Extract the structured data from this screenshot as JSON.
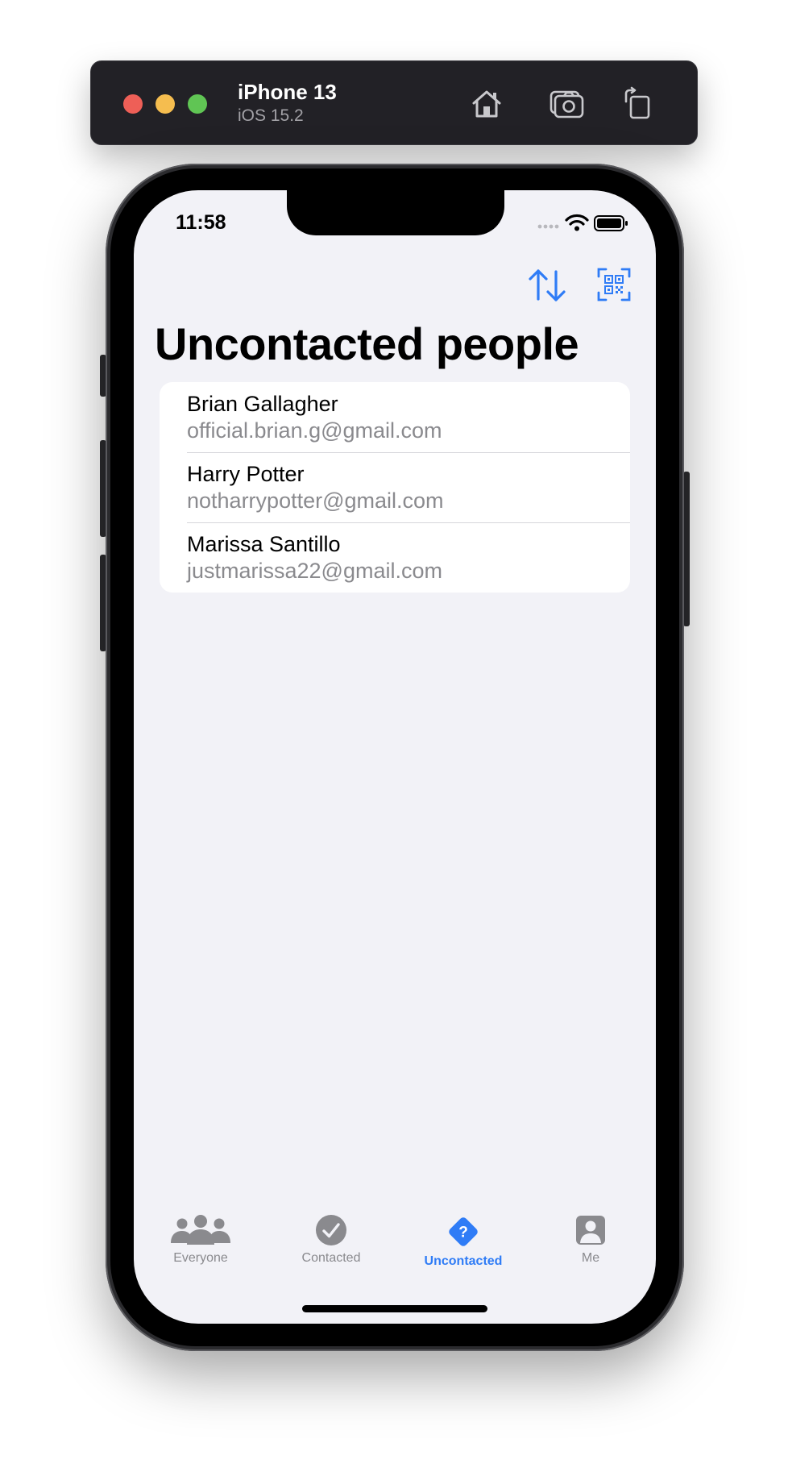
{
  "simulator": {
    "device_name": "iPhone 13",
    "os_version": "iOS 15.2",
    "buttons": {
      "home": "house-icon",
      "screenshot": "camera-icon",
      "rotate": "rotate-icon"
    }
  },
  "status_bar": {
    "time": "11:58"
  },
  "nav": {
    "title": "Uncontacted people",
    "actions": [
      "sort-arrows-icon",
      "qr-scan-icon"
    ]
  },
  "contacts": [
    {
      "name": "Brian Gallagher",
      "email": "official.brian.g@gmail.com"
    },
    {
      "name": "Harry Potter",
      "email": "notharrypotter@gmail.com"
    },
    {
      "name": "Marissa Santillo",
      "email": "justmarissa22@gmail.com"
    }
  ],
  "tabs": [
    {
      "label": "Everyone",
      "icon": "people-icon",
      "active": false
    },
    {
      "label": "Contacted",
      "icon": "checkmark-circle-icon",
      "active": false
    },
    {
      "label": "Uncontacted",
      "icon": "question-diamond-icon",
      "active": true
    },
    {
      "label": "Me",
      "icon": "person-square-icon",
      "active": false
    }
  ],
  "colors": {
    "accent": "#2f7cf6",
    "inactive": "#8a8a8e",
    "background": "#f2f2f7"
  }
}
